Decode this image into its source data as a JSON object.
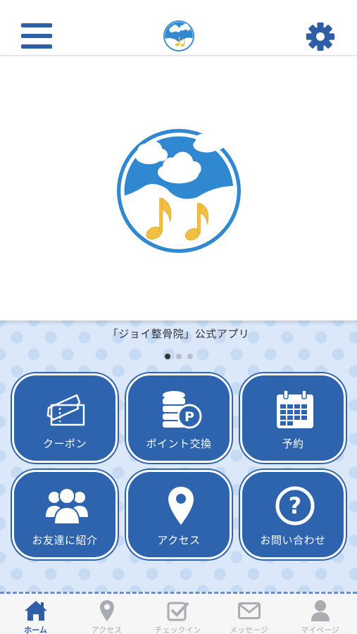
{
  "header": {
    "menu_icon": "hamburger-menu-icon",
    "logo": "joy-seikotsuin-logo",
    "settings_icon": "gear-icon"
  },
  "hero": {
    "logo": "joy-seikotsuin-logo-large"
  },
  "panel": {
    "app_title": "「ジョイ整骨院」公式アプリ",
    "carousel": {
      "count": 3,
      "active": 1
    },
    "tiles": [
      {
        "label": "クーポン",
        "icon": "ticket-icon"
      },
      {
        "label": "ポイント交換",
        "icon": "coins-icon"
      },
      {
        "label": "予約",
        "icon": "calendar-icon"
      },
      {
        "label": "お友達に紹介",
        "icon": "users-icon"
      },
      {
        "label": "アクセス",
        "icon": "map-pin-icon"
      },
      {
        "label": "お問い合わせ",
        "icon": "question-icon"
      }
    ]
  },
  "tabbar": {
    "tabs": [
      {
        "label": "ホーム",
        "icon": "home-icon",
        "active": true
      },
      {
        "label": "アクセス",
        "icon": "map-pin-icon",
        "active": false
      },
      {
        "label": "チェックイン",
        "icon": "checkin-icon",
        "active": false
      },
      {
        "label": "メッセージ",
        "icon": "envelope-icon",
        "active": false
      },
      {
        "label": "マイページ",
        "icon": "person-icon",
        "active": false
      }
    ]
  },
  "colors": {
    "primary": "#2e63ad",
    "accent": "#2f5ea8",
    "panel_bg": "#dbe8f9",
    "inactive": "#a9acb1"
  }
}
